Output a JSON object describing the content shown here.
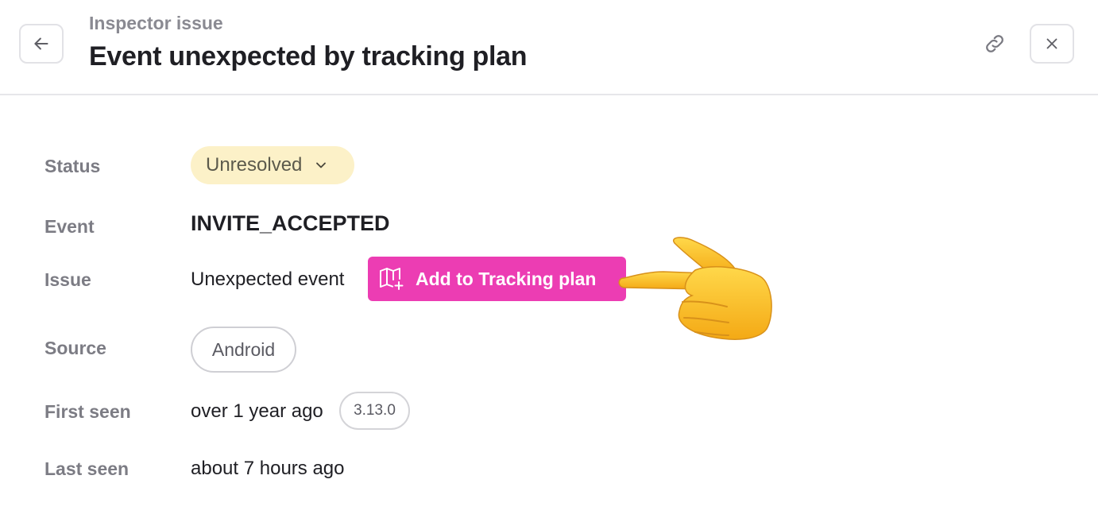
{
  "header": {
    "subtitle": "Inspector issue",
    "title": "Event unexpected by tracking plan",
    "back_icon": "arrow-left-icon",
    "link_icon": "link-icon",
    "close_icon": "close-icon"
  },
  "details": {
    "status": {
      "label": "Status",
      "value": "Unresolved",
      "pill_color": "#fcf1c8"
    },
    "event": {
      "label": "Event",
      "value": "INVITE_ACCEPTED"
    },
    "issue": {
      "label": "Issue",
      "value": "Unexpected event",
      "action_label": "Add to Tracking plan",
      "action_icon": "map-plus-icon",
      "action_color": "#ec3db3"
    },
    "source": {
      "label": "Source",
      "value": "Android"
    },
    "first_seen": {
      "label": "First seen",
      "value": "over 1 year ago",
      "version": "3.13.0"
    },
    "last_seen": {
      "label": "Last seen",
      "value": "about 7 hours ago"
    }
  },
  "annotation": {
    "icon": "pointing-hand-icon"
  }
}
